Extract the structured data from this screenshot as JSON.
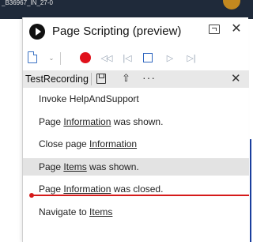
{
  "background": {
    "top_title": "_B36967_IN_27-0"
  },
  "pane": {
    "title": "Page Scripting (preview)"
  },
  "toolbar": {
    "new_icon": "new-file-icon",
    "record_icon": "record-icon",
    "rewind_icon": "rewind-icon",
    "step_back_icon": "step-back-icon",
    "stop_icon": "stop-icon",
    "play_icon": "play-icon",
    "skip_end_icon": "skip-end-icon"
  },
  "recording": {
    "name": "TestRecording"
  },
  "steps": [
    {
      "pre": "Invoke HelpAndSupport",
      "link": "",
      "post": ""
    },
    {
      "pre": "Page ",
      "link": "Information",
      "post": " was shown."
    },
    {
      "pre": "Close page ",
      "link": "Information",
      "post": ""
    },
    {
      "pre": "Page ",
      "link": "Items",
      "post": " was shown."
    },
    {
      "pre": "Page ",
      "link": "Information",
      "post": " was closed."
    },
    {
      "pre": "Navigate to ",
      "link": "Items",
      "post": ""
    }
  ],
  "colors": {
    "accent": "#2f66c0",
    "record": "#e0111b",
    "insert_line": "#d51a1a"
  }
}
